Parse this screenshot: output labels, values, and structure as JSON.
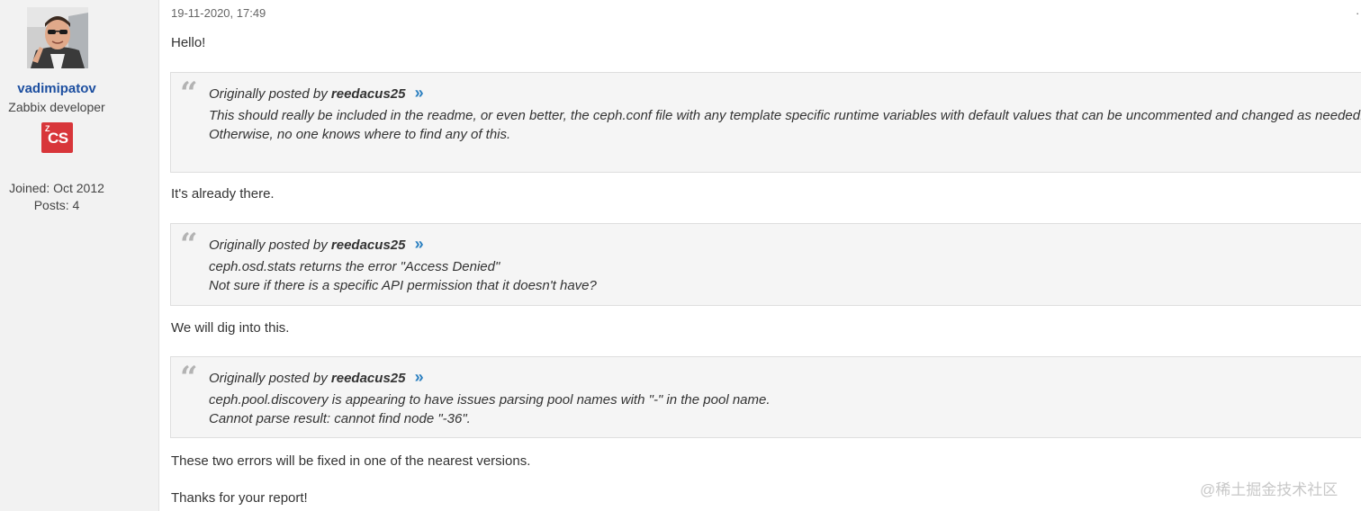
{
  "user": {
    "name": "vadimipatov",
    "title": "Zabbix developer",
    "badge_sup": "Z",
    "badge_main": "CS",
    "joined": "Joined: Oct 2012",
    "posts": "Posts: 4"
  },
  "post": {
    "date": "19-11-2020, 17:49",
    "corner_mark": "·",
    "greeting": "Hello!",
    "quote_prefix": "Originally posted by",
    "quotes": [
      {
        "author": "reedacus25",
        "lines": [
          "This should really be included in the readme, or even better, the ceph.conf file with any template specific runtime variables with default values that can be uncommented and changed as needed.",
          "Otherwise, no one knows where to find any of this."
        ]
      },
      {
        "author": "reedacus25",
        "lines": [
          "ceph.osd.stats returns the error \"Access Denied\"",
          "Not sure if there is a specific API permission that it doesn't have?"
        ]
      },
      {
        "author": "reedacus25",
        "lines": [
          "ceph.pool.discovery is appearing to have issues parsing pool names with \"-\" in the pool name.",
          "Cannot parse result: cannot find node \"-36\"."
        ]
      }
    ],
    "reply_1": "It's already there.",
    "reply_2": "We will dig into this.",
    "reply_3": "These two errors will be fixed in one of the nearest versions.",
    "reply_4": "Thanks for your report!"
  },
  "quote_glyph": "“",
  "jump_glyph": "»",
  "watermark": "@稀土掘金技术社区",
  "colors": {
    "sidebar_bg": "#f2f2f2",
    "username": "#1d4fa0",
    "badge": "#d8363a",
    "quote_bg": "#f5f5f5",
    "jump_link": "#2a7fc0"
  }
}
